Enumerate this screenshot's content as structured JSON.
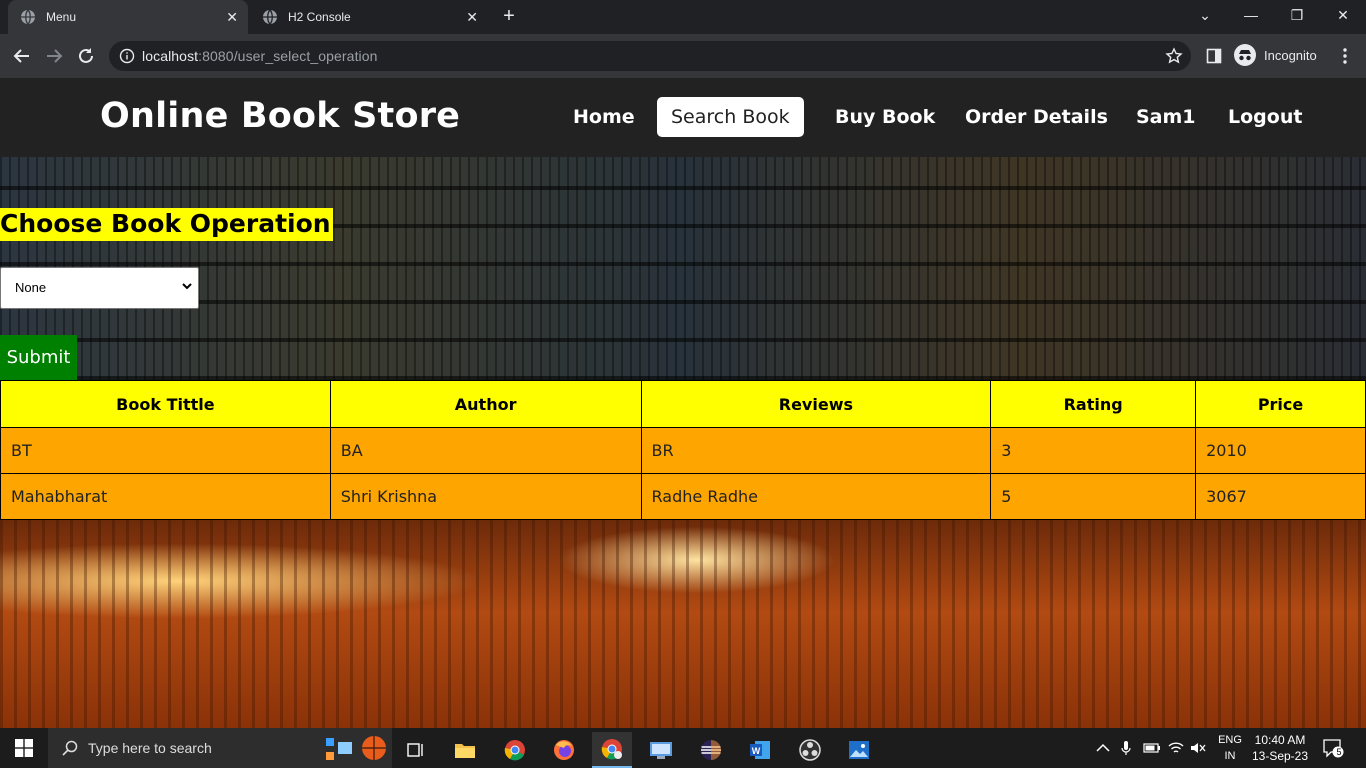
{
  "browser": {
    "tabs": [
      {
        "title": "Menu",
        "active": true
      },
      {
        "title": "H2 Console",
        "active": false
      }
    ],
    "url_host": "localhost",
    "url_path": ":8080/user_select_operation",
    "profile_label": "Incognito"
  },
  "site": {
    "brand": "Online Book Store",
    "nav": [
      {
        "label": "Home",
        "active": false
      },
      {
        "label": "Search Book",
        "active": true
      },
      {
        "label": "Buy Book",
        "active": false
      },
      {
        "label": "Order Details",
        "active": false
      },
      {
        "label": "Sam1",
        "active": false
      },
      {
        "label": "Logout",
        "active": false
      }
    ]
  },
  "operation": {
    "title": "Choose Book Operation",
    "selected": "None",
    "submit_label": "Submit"
  },
  "table": {
    "headers": [
      "Book Tittle",
      "Author",
      "Reviews",
      "Rating",
      "Price"
    ],
    "rows": [
      [
        "BT",
        "BA",
        "BR",
        "3",
        "2010"
      ],
      [
        "Mahabharat",
        "Shri Krishna",
        "Radhe Radhe",
        "5",
        "3067"
      ]
    ]
  },
  "taskbar": {
    "search_placeholder": "Type here to search",
    "lang_line1": "ENG",
    "lang_line2": "IN",
    "time": "10:40 AM",
    "date": "13-Sep-23",
    "notifications": "5"
  },
  "colors": {
    "header_bg": "#222222",
    "title_highlight": "#ffff00",
    "table_header": "#ffff00",
    "table_cell": "#ffa500",
    "submit": "#008000"
  }
}
